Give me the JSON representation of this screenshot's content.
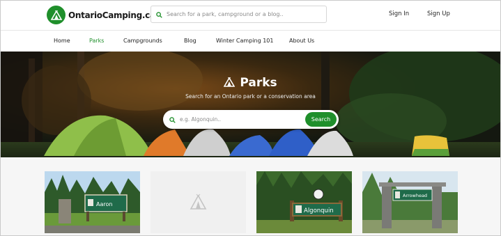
{
  "header": {
    "logo_text": "OntarioCamping.ca",
    "search_placeholder": "Search for a park, campground or a blog..",
    "sign_in": "Sign In",
    "sign_up": "Sign Up"
  },
  "nav": {
    "items": [
      {
        "label": "Home",
        "active": false
      },
      {
        "label": "Parks",
        "active": true
      },
      {
        "label": "Campgrounds",
        "active": false
      },
      {
        "label": "Blog",
        "active": false
      },
      {
        "label": "Winter Camping 101",
        "active": false
      },
      {
        "label": "About Us",
        "active": false
      }
    ]
  },
  "hero": {
    "title": "Parks",
    "subtitle": "Search for an Ontario park or a conservation area",
    "search_placeholder": "e.g. Algonquin..",
    "search_button": "Search"
  },
  "cards": [
    {
      "sign_text": "Aaron",
      "icon": "park-photo"
    },
    {
      "sign_text": "",
      "icon": "tent-placeholder-icon"
    },
    {
      "sign_text": "Algonquin",
      "icon": "park-photo"
    },
    {
      "sign_text": "Arrowhead",
      "icon": "park-photo"
    }
  ],
  "colors": {
    "brand_green": "#1f8f2b",
    "nav_active": "#1f8f2b"
  }
}
